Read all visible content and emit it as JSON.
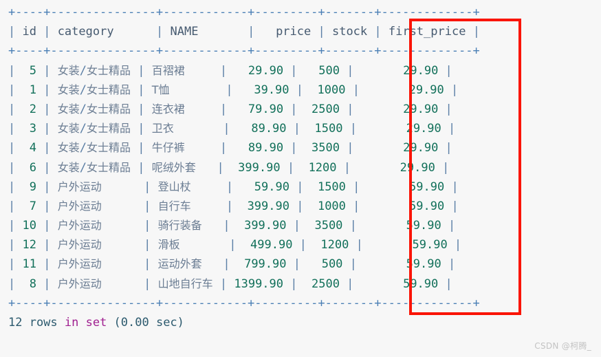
{
  "terminal": {
    "border_rule": "+----+---------------+------------+---------+-------+-------------+",
    "columns": [
      {
        "name": "id",
        "label": "id",
        "width": 4,
        "align": "right"
      },
      {
        "name": "category",
        "label": "category",
        "width": 15,
        "align": "left"
      },
      {
        "name": "NAME",
        "label": "NAME",
        "width": 12,
        "align": "left"
      },
      {
        "name": "price",
        "label": "price",
        "width": 9,
        "align": "right"
      },
      {
        "name": "stock",
        "label": "stock",
        "width": 7,
        "align": "right"
      },
      {
        "name": "first_price",
        "label": "first_price",
        "width": 13,
        "align": "right"
      }
    ],
    "header_labels": {
      "id": "id",
      "category": "category",
      "name": "NAME",
      "price": "price",
      "stock": "stock",
      "first_price": "first_price"
    },
    "rows": [
      {
        "id": "5",
        "category": "女装/女士精品",
        "name": "百褶裙",
        "price": "29.90",
        "stock": "500",
        "first_price": "29.90"
      },
      {
        "id": "1",
        "category": "女装/女士精品",
        "name": "T恤",
        "price": "39.90",
        "stock": "1000",
        "first_price": "29.90"
      },
      {
        "id": "2",
        "category": "女装/女士精品",
        "name": "连衣裙",
        "price": "79.90",
        "stock": "2500",
        "first_price": "29.90"
      },
      {
        "id": "3",
        "category": "女装/女士精品",
        "name": "卫衣",
        "price": "89.90",
        "stock": "1500",
        "first_price": "29.90"
      },
      {
        "id": "4",
        "category": "女装/女士精品",
        "name": "牛仔裤",
        "price": "89.90",
        "stock": "3500",
        "first_price": "29.90"
      },
      {
        "id": "6",
        "category": "女装/女士精品",
        "name": "呢绒外套",
        "price": "399.90",
        "stock": "1200",
        "first_price": "29.90"
      },
      {
        "id": "9",
        "category": "户外运动",
        "name": "登山杖",
        "price": "59.90",
        "stock": "1500",
        "first_price": "59.90"
      },
      {
        "id": "7",
        "category": "户外运动",
        "name": "自行车",
        "price": "399.90",
        "stock": "1000",
        "first_price": "59.90"
      },
      {
        "id": "10",
        "category": "户外运动",
        "name": "骑行装备",
        "price": "399.90",
        "stock": "3500",
        "first_price": "59.90"
      },
      {
        "id": "12",
        "category": "户外运动",
        "name": "滑板",
        "price": "499.90",
        "stock": "1200",
        "first_price": "59.90"
      },
      {
        "id": "11",
        "category": "户外运动",
        "name": "运动外套",
        "price": "799.90",
        "stock": "500",
        "first_price": "59.90"
      },
      {
        "id": "8",
        "category": "户外运动",
        "name": "山地自行车",
        "price": "1399.90",
        "stock": "2500",
        "first_price": "59.90"
      }
    ],
    "status": {
      "count": "12 rows",
      "keyword": "in set",
      "timing": "(0.00 sec)",
      "full": "12 rows in set (0.00 sec)"
    }
  },
  "annotation": {
    "highlight_column": "first_price",
    "color": "#fa1405"
  },
  "watermark": {
    "text": "CSDN @柯腾_"
  }
}
